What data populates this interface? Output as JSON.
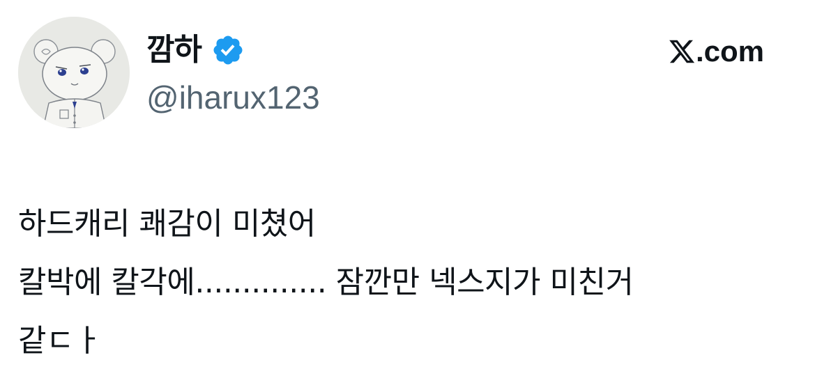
{
  "author": {
    "display_name": "깜하",
    "handle": "@iharux123",
    "verified": true,
    "verified_icon": "verified-badge-icon",
    "avatar": "avatar-drawing"
  },
  "site": {
    "logo_icon": "x-logo-icon",
    "domain": ".com"
  },
  "tweet": {
    "lines": [
      "하드캐리 쾌감이 미쳤어",
      "칼박에 칼각에.............. 잠깐만 넥스지가 미친거",
      "같ㄷㅏ"
    ]
  },
  "colors": {
    "background": "#ffffff",
    "text_primary": "#0f1419",
    "text_secondary": "#536471",
    "verified_blue": "#1d9bf0"
  }
}
